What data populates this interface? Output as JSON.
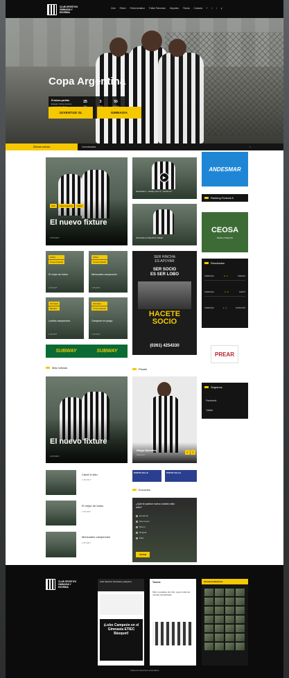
{
  "header": {
    "logo_text": "CLUB SPORTIVO GIMNASIA Y ESGRIMA",
    "nav": [
      "Club",
      "Fútbol",
      "Fútbol Amateur",
      "Fútbol Femenino",
      "Deportes",
      "Tienda",
      "Contacto"
    ],
    "social": [
      "f",
      "t",
      "i",
      "y"
    ]
  },
  "hero": {
    "title": "Copa Argentina",
    "next_match_label": "Próximo partido",
    "next_match_info": "Estadio Víctor Antonio Legrotaglie 18 hs",
    "countdown": [
      {
        "value": "25",
        "label": "días"
      },
      {
        "value": "3",
        "label": "horas"
      },
      {
        "value": "50",
        "label": "minutos"
      }
    ],
    "team_home": "JUVENTUD SL",
    "team_away": "GIMNASIA"
  },
  "tabs": {
    "active": "Últimas noticias",
    "second": "Comunicados",
    "more": "›"
  },
  "news": {
    "featured": {
      "tags": [
        "Club",
        "Copa Argentina",
        "Fútbol"
      ],
      "title": "El nuevo fixture",
      "date": "11.05.2017"
    },
    "video1": "Gimnasia 1 - Godoy Cruz 2 - Fecha 14",
    "video2": "Gimnasia vs Deportivo Maipú",
    "small": [
      {
        "tags": [
          "Fútbol",
          "Torneo Federal"
        ],
        "title": "El mejor de todos",
        "date": "1.05.2017"
      },
      {
        "tags": [
          "Fútbol",
          "Torneo Federal"
        ],
        "title": "Mensuales campeones",
        "date": "1.05.2017"
      },
      {
        "tags": [
          "Gimnasia",
          "Básquet"
        ],
        "title": "Lobitos campeones",
        "date": "1.05.2017"
      },
      {
        "tags": [
          "Gimnasia",
          "Torneo Federal"
        ],
        "title": "Campeón en juego",
        "date": "1.05.2017"
      }
    ],
    "socio_ad": {
      "line1": "SER HINCHA",
      "line2": "ES APOYAR",
      "line3": "SER SOCIO",
      "line4": "ES SER LOBO",
      "cta": "HACETE SOCIO",
      "phone": "(0261) 4254330"
    },
    "banner": "SUBWAY"
  },
  "sidebar": {
    "ad1": "ANDESMAR",
    "ranking": "Ranking Federal A",
    "ad2": "CEOSA",
    "ad2_sub": "Desde el Deporte",
    "results_title": "Resultados",
    "results": [
      {
        "home": "GIMNASIA",
        "score": "3 - 1",
        "away": "ATENAS"
      },
      {
        "home": "GIMNASIA",
        "score": "2 - 0",
        "away": "MAIPÚ"
      },
      {
        "home": "GIMNASIA",
        "score": "1 - 1",
        "away": "HURACÁN"
      }
    ],
    "ad3": "PREAR",
    "follow_title": "Seguinos",
    "follow": [
      "Facebook",
      "Twitter"
    ]
  },
  "more_news": {
    "heading": "Más noticias",
    "featured": {
      "title": "El nuevo fixture",
      "date": "11.05.2017"
    },
    "list": [
      {
        "title": "Camil el sitio",
        "date": "1.05.2017"
      },
      {
        "title": "El mejor de todos",
        "date": "1.05.2017"
      },
      {
        "title": "Mensuales campeones",
        "date": "1.05.2017"
      }
    ]
  },
  "plantel": {
    "heading": "Plantel",
    "player_name": "Diego Mondino",
    "player_role": "Defensor",
    "ads": [
      "PUNTO VALLE",
      "PUNTO VALLE"
    ]
  },
  "poll": {
    "heading": "Encuesta",
    "question": "¿Qué te parece nuevo nuestro sitio web?",
    "options": [
      "Excelente",
      "Muy bueno",
      "Bueno",
      "Regular",
      "Malo"
    ],
    "submit": "VOTAR"
  },
  "footer": {
    "logo_text": "CLUB SPORTIVO GIMNASIA Y ESGRIMA",
    "fb_title": "Club Sportivo Gimnasia y Esgrima",
    "fb_post": "¡Lobo Campeón en el Gimnasia ETIEC Básquet!",
    "tw_title": "Tweets",
    "tw_post": "Más novedades del club, seguí todas las noticias actualizadas",
    "ig_title": "Gimnasia Mendoza",
    "copyright": "Todos los derechos reservados"
  }
}
